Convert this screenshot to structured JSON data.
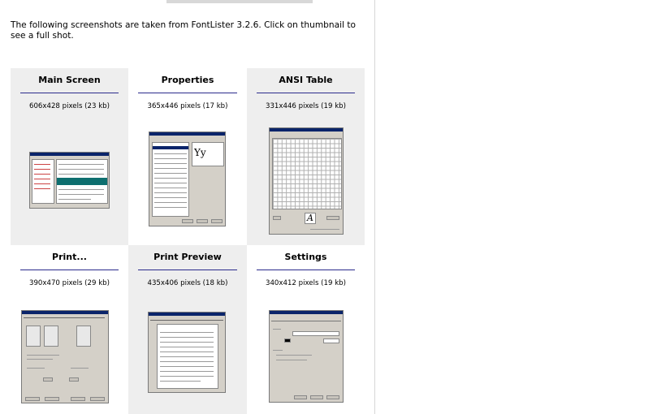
{
  "intro": "The following screenshots are taken from FontLister 3.2.6. Click on thumbnail to see a full shot.",
  "items": [
    {
      "title": "Main Screen",
      "size": "606x428 pixels (23 kb)"
    },
    {
      "title": "Properties",
      "size": "365x446 pixels (17 kb)"
    },
    {
      "title": "ANSI Table",
      "size": "331x446 pixels (19 kb)"
    },
    {
      "title": "Print...",
      "size": "390x470 pixels (29 kb)"
    },
    {
      "title": "Print Preview",
      "size": "435x406 pixels (18 kb)"
    },
    {
      "title": "Settings",
      "size": "340x412 pixels (19 kb)"
    }
  ],
  "thumb_text": {
    "properties_sample": "Yy",
    "ansi_sample": "A"
  }
}
